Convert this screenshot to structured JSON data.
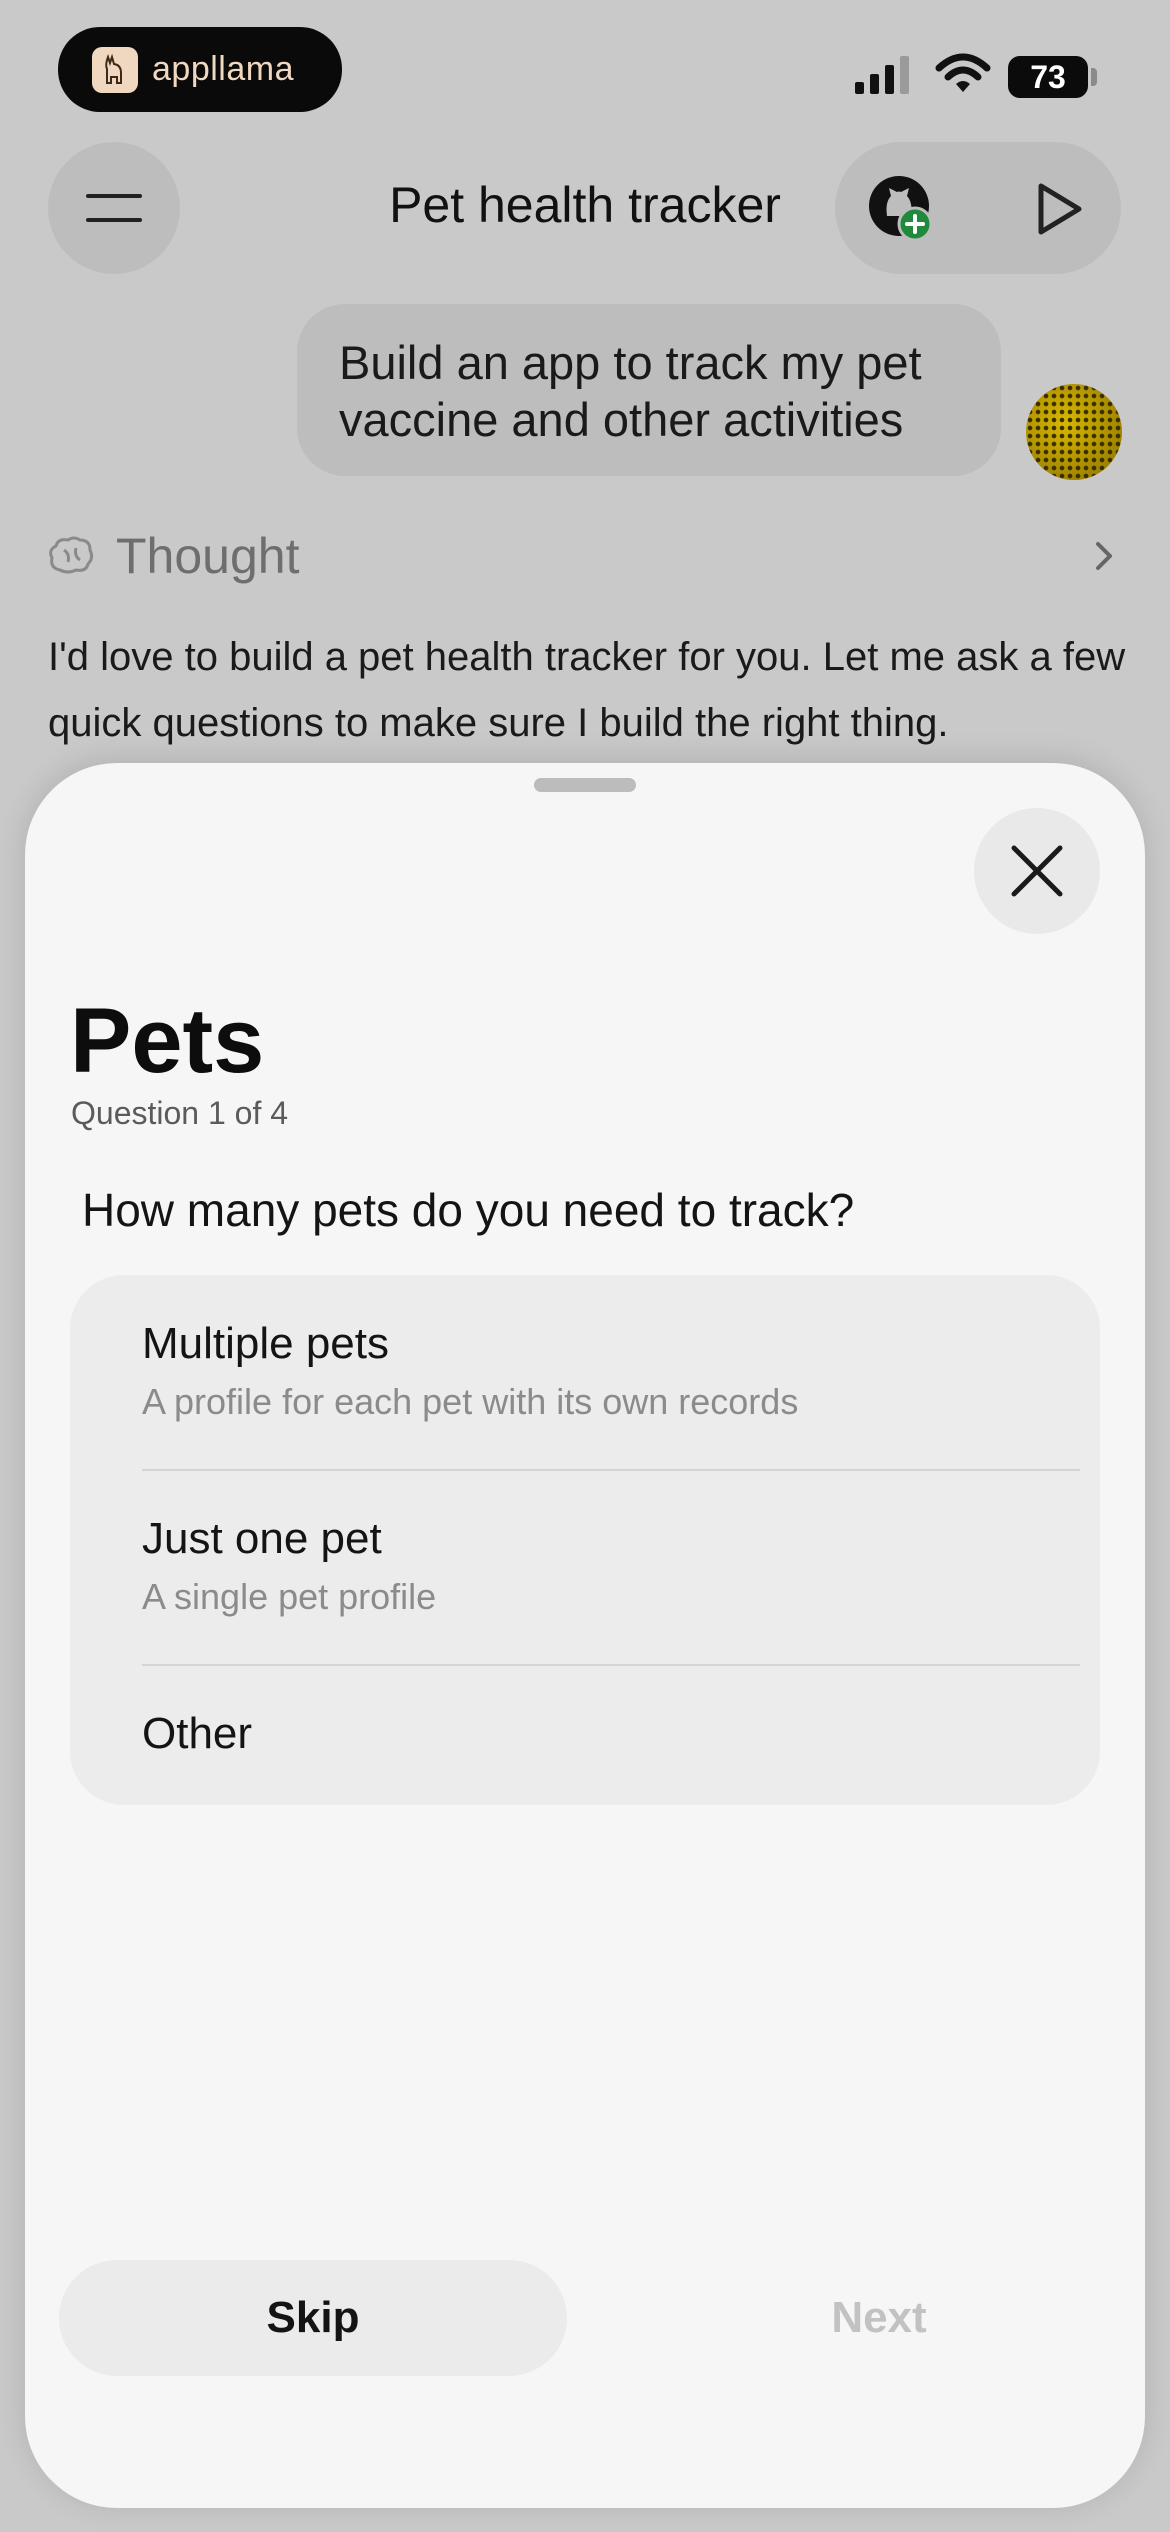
{
  "status_bar": {
    "brand_name": "appllama",
    "battery_level": "73"
  },
  "header": {
    "title": "Pet health tracker"
  },
  "chat": {
    "user_message": "Build an app to track my pet vaccine and other activities",
    "thought_label": "Thought",
    "assistant_message": "I'd love to build a pet health tracker for you. Let me ask a few quick questions to make sure I build the right thing."
  },
  "sheet": {
    "title": "Pets",
    "progress": "Question 1 of 4",
    "question": "How many pets do you need to track?",
    "options": [
      {
        "title": "Multiple pets",
        "description": "A profile for each pet with its own records"
      },
      {
        "title": "Just one pet",
        "description": "A single pet profile"
      },
      {
        "title": "Other",
        "description": ""
      }
    ],
    "skip_label": "Skip",
    "next_label": "Next"
  },
  "colors": {
    "accent_green": "#1f8a3b",
    "avatar_gold": "#c9a800",
    "disabled_text": "#c2c2c2"
  }
}
